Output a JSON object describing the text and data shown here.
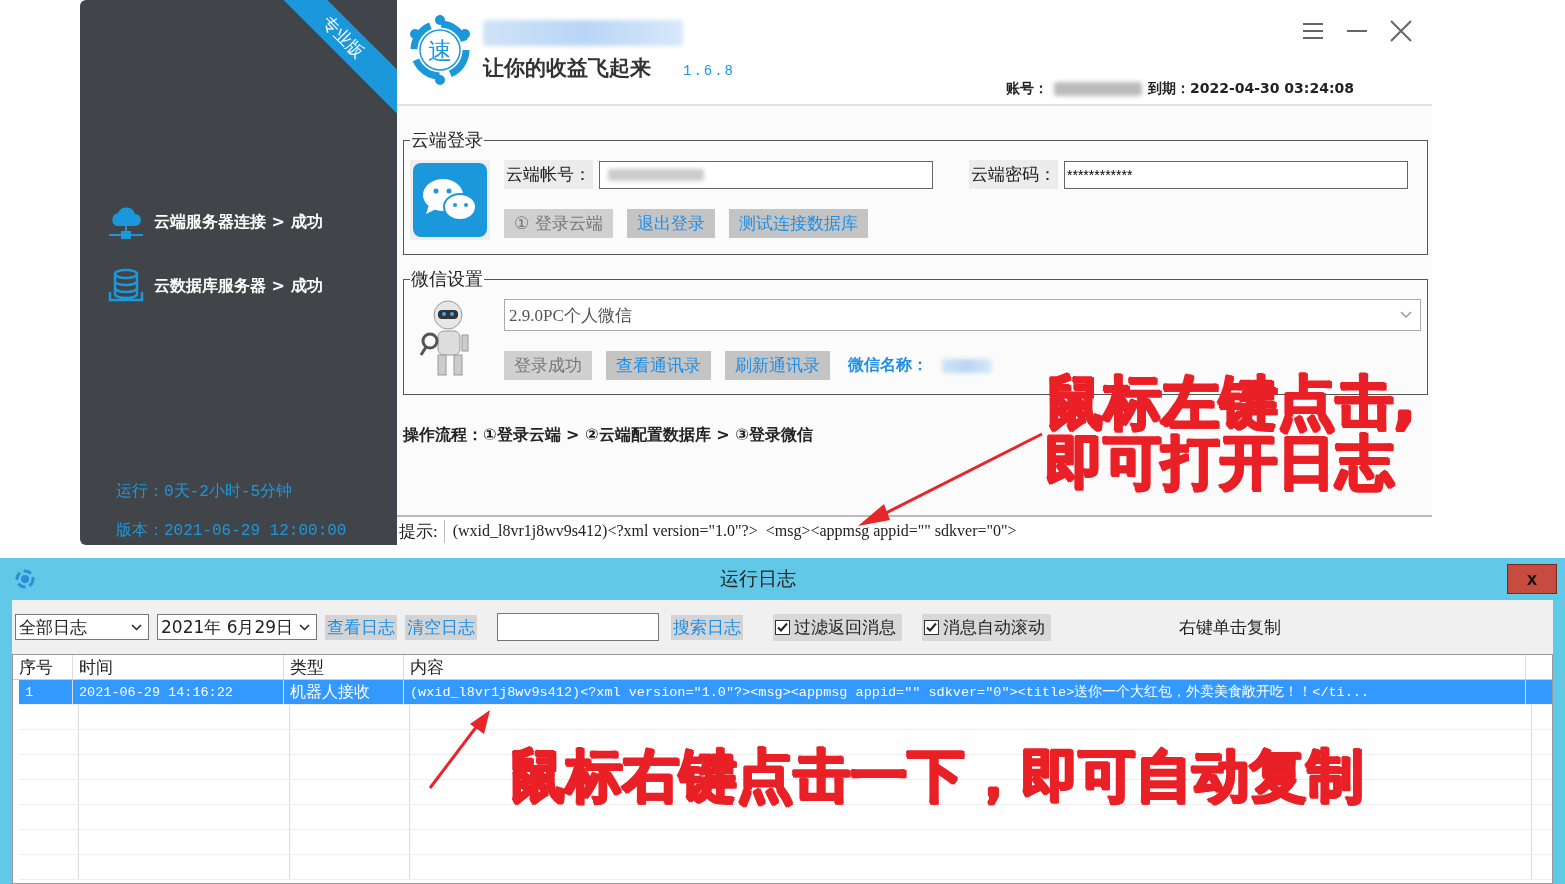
{
  "main_window": {
    "ribbon": "专业版",
    "sidebar": {
      "status_items": [
        {
          "kind": "cloud",
          "label": "云端服务器连接 > 成功"
        },
        {
          "kind": "database",
          "label": "云数据库服务器 > 成功"
        }
      ],
      "runtime": "运行：0天-2小时-5分钟",
      "version": "版本：2021-06-29 12:00:00"
    },
    "header": {
      "logo_char": "速",
      "slogan": "让你的收益飞起来",
      "version": "1.6.8",
      "account_label": "账号：",
      "expiry": "到期：2022-04-30 03:24:08"
    },
    "cloud_login": {
      "title": "云端登录",
      "account_label": "云端帐号：",
      "password_label": "云端密码：",
      "password_value": "************",
      "buttons": [
        {
          "label": "① 登录云端",
          "disabled": true
        },
        {
          "label": "退出登录",
          "disabled": false
        },
        {
          "label": "测试连接数据库",
          "disabled": false
        }
      ]
    },
    "wechat_settings": {
      "title": "微信设置",
      "version_select": "2.9.0PC个人微信",
      "buttons": [
        {
          "label": "登录成功",
          "disabled": true
        },
        {
          "label": "查看通讯录",
          "disabled": false
        },
        {
          "label": "刷新通讯录",
          "disabled": false
        }
      ],
      "name_label": "微信名称："
    },
    "process": "操作流程：①登录云端 > ②云端配置数据库 > ③登录微信",
    "hint": {
      "label": "提示:",
      "text": "(wxid_l8vr1j8wv9s412)<?xml version=\"1.0\"?>  <msg><appmsg appid=\"\" sdkver=\"0\">"
    }
  },
  "log_window": {
    "title": "运行日志",
    "close": "x",
    "toolbar": {
      "filter_select": "全部日志",
      "date": "2021年 6月29日",
      "buttons": [
        "查看日志",
        "清空日志"
      ],
      "search_button": "搜索日志",
      "checkboxes": [
        {
          "label": "过滤返回消息",
          "checked": true
        },
        {
          "label": "消息自动滚动",
          "checked": true
        }
      ],
      "tip": "右键单击复制"
    },
    "table": {
      "columns": [
        "序号",
        "时间",
        "类型",
        "内容"
      ],
      "rows": [
        {
          "cells": [
            "1",
            "2021-06-29 14:16:22",
            "机器人接收",
            "(wxid_l8vr1j8wv9s412)<?xml version=\"1.0\"?><msg><appmsg appid=\"\" sdkver=\"0\"><title>送你一个大红包，外卖美食敞开吃！！</ti..."
          ],
          "selected": true
        }
      ]
    }
  },
  "annotations": [
    {
      "lines": [
        "鼠标左键点击,",
        "即可打开日志"
      ]
    },
    {
      "lines": [
        "鼠标右键点击一下，即可自动复制"
      ]
    }
  ]
}
